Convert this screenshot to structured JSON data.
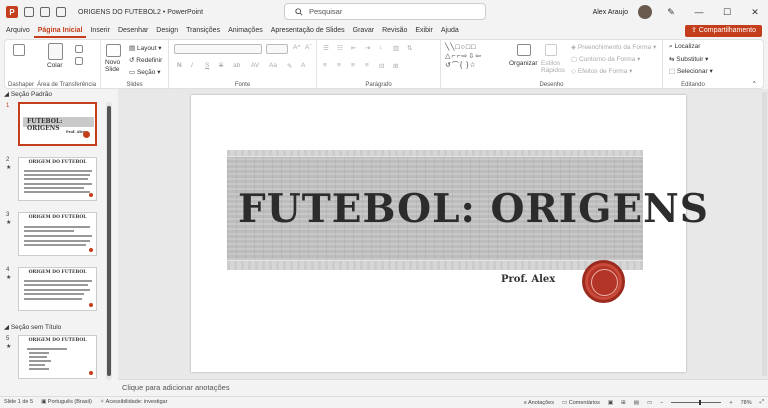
{
  "titlebar": {
    "doc_title": "ORIGENS DO FUTEBOL2",
    "app_name": "PowerPoint",
    "separator": "•",
    "search_placeholder": "Pesquisar",
    "user_name": "Alex Araujo",
    "logo_letter": "P"
  },
  "menu": {
    "items": [
      "Arquivo",
      "Página Inicial",
      "Inserir",
      "Desenhar",
      "Design",
      "Transições",
      "Animações",
      "Apresentação de Slides",
      "Gravar",
      "Revisão",
      "Exibir",
      "Ajuda"
    ],
    "active_index": 1,
    "share_label": "Compartilhamento"
  },
  "ribbon": {
    "clipboard": {
      "paste": "Colar",
      "label_a": "Dashaper",
      "label_b": "Área de Transferência"
    },
    "slides": {
      "new_slide": "Novo Slide",
      "layout": "Layout",
      "reset": "Redefinir",
      "section": "Seção",
      "label": "Slides"
    },
    "font": {
      "label": "Fonte",
      "bold": "N",
      "italic": "I",
      "underline": "S",
      "strike": "S",
      "abc": "ab",
      "az": "AV",
      "aa": "Aa"
    },
    "paragraph": {
      "label": "Parágrafo"
    },
    "drawing": {
      "arrange": "Organizar",
      "quick_styles": "Estilos Rápidos",
      "fill": "Preenchimento da Forma",
      "outline": "Contorno da Forma",
      "effects": "Efeitos de Forma",
      "label": "Desenho"
    },
    "editing": {
      "find": "Localizar",
      "replace": "Substituir",
      "select": "Selecionar",
      "label": "Editando"
    }
  },
  "sections": [
    {
      "title": "Seção Padrão"
    },
    {
      "title": "Seção sem Título"
    }
  ],
  "thumbnails": [
    {
      "num": "1",
      "title": "FUTEBOL: ORIGENS",
      "author": "Prof. Alex"
    },
    {
      "num": "2",
      "title": "ORIGEM DO FUTEBOL"
    },
    {
      "num": "3",
      "title": "ORIGEM DO FUTEBOL"
    },
    {
      "num": "4",
      "title": "ORIGEM DO FUTEBOL"
    },
    {
      "num": "5",
      "title": "ORIGEM DO FUTEBOL"
    }
  ],
  "slide": {
    "title": "FUTEBOL: ORIGENS",
    "subtitle": "Prof. Alex"
  },
  "notes_placeholder": "Clique para adicionar anotações",
  "status": {
    "slide_of": "Slide 1 de 5",
    "language": "Português (Brasil)",
    "accessibility": "Acessibilidade: investigar",
    "notes": "Anotações",
    "comments": "Comentários",
    "zoom": "78%"
  },
  "colors": {
    "accent": "#c43e1c",
    "seal": "#b33527"
  }
}
